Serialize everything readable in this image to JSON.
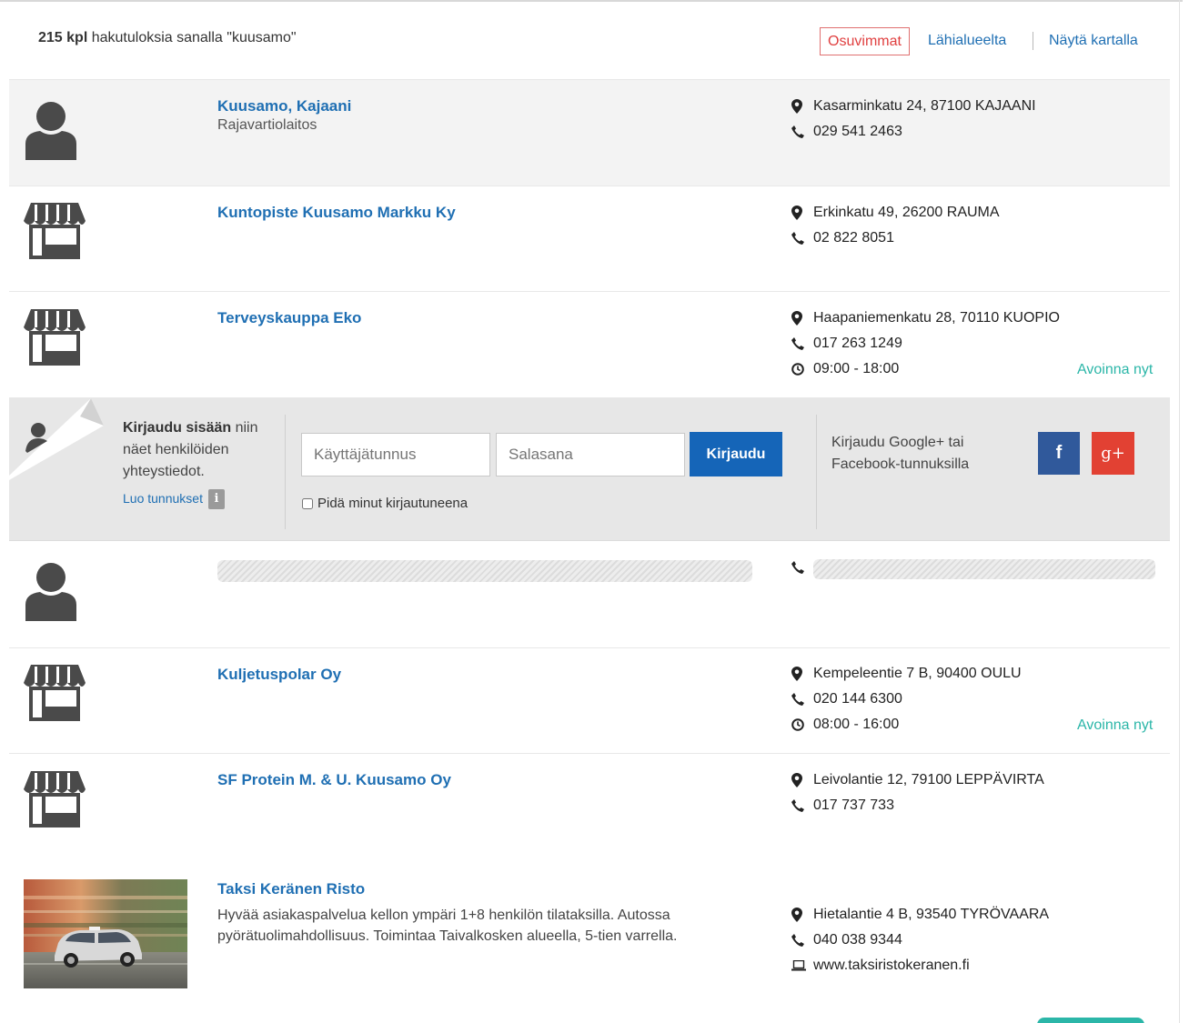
{
  "header": {
    "count": "215 kpl",
    "query_text": "hakutuloksia sanalla \"kuusamo\"",
    "sort_relevant": "Osuvimmat",
    "sort_nearby": "Lähialueelta",
    "show_map": "Näytä kartalla"
  },
  "results": [
    {
      "name": "Kuusamo, Kajaani",
      "subtitle": "Rajavartiolaitos",
      "address": "Kasarminkatu 24, 87100 KAJAANI",
      "phone": "029 541 2463",
      "icon": "person-icon"
    },
    {
      "name": "Kuntopiste Kuusamo Markku Ky",
      "address": "Erkinkatu 49, 26200 RAUMA",
      "phone": "02 822 8051",
      "icon": "shop-icon"
    },
    {
      "name": "Terveyskauppa Eko",
      "address": "Haapaniemenkatu 28, 70110 KUOPIO",
      "phone": "017 263 1249",
      "hours": "09:00 - 18:00",
      "status": "Avoinna nyt",
      "icon": "shop-icon"
    },
    {
      "name": "Kuljetuspolar Oy",
      "address": "Kempeleentie 7 B, 90400 OULU",
      "phone": "020 144 6300",
      "hours": "08:00 - 16:00",
      "status": "Avoinna nyt",
      "icon": "shop-icon"
    },
    {
      "name": "SF Protein M. & U. Kuusamo Oy",
      "address": "Leivolantie 12, 79100 LEPPÄVIRTA",
      "phone": "017 737 733",
      "icon": "shop-icon"
    },
    {
      "name": "Taksi Keränen Risto",
      "description": "Hyvää asiakaspalvelua kellon ympäri 1+8 henkilön tilataksilla. Autossa pyörätuolimahdollisuus. Toimintaa Taivalkosken alueella, 5-tien varrella.",
      "address": "Hietalantie 4 B, 93540 TYRÖVAARA",
      "phone": "040 038 9344",
      "website": "www.taksiristokeranen.fi",
      "icon": "taxi-photo"
    }
  ],
  "login": {
    "bold": "Kirjaudu sisään",
    "text": " niin näet henkilöiden yhteystiedot.",
    "create_link": "Luo tunnukset",
    "info_badge": "i",
    "username_placeholder": "Käyttäjätunnus",
    "password_placeholder": "Salasana",
    "submit": "Kirjaudu",
    "remember": "Pidä minut kirjautuneena",
    "social_text": "Kirjaudu Google+ tai Facebook-tunnuksilla",
    "facebook": "f",
    "google": "g+"
  },
  "colors": {
    "link": "#1f6fb3",
    "open": "#2bb6a8",
    "active_sort": "#e04040",
    "login_button": "#1565b8",
    "facebook": "#30599b",
    "google": "#e24133"
  }
}
